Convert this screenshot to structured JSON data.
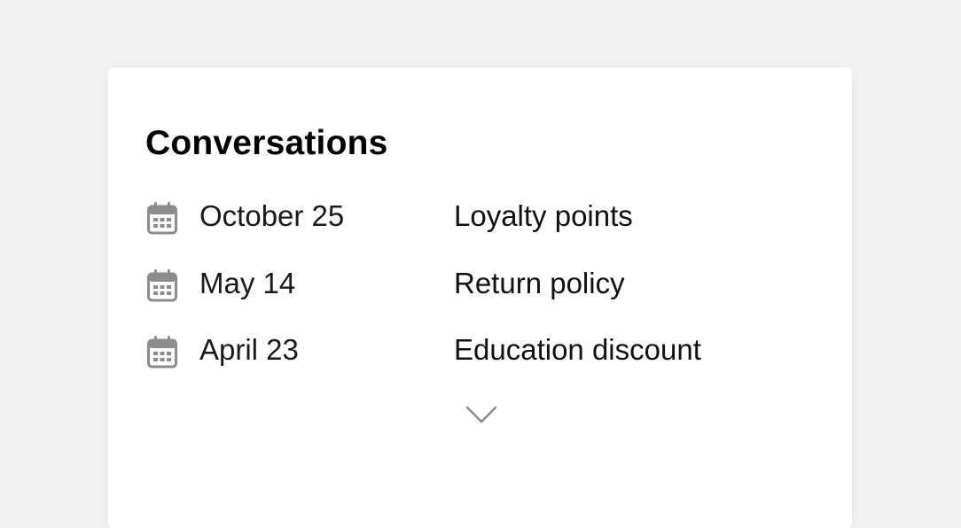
{
  "card": {
    "title": "Conversations",
    "rows": [
      {
        "date": "October 25",
        "topic": "Loyalty points",
        "icon": "calendar-icon"
      },
      {
        "date": "May 14",
        "topic": "Return policy",
        "icon": "calendar-icon"
      },
      {
        "date": "April 23",
        "topic": "Education discount",
        "icon": "calendar-icon"
      }
    ],
    "expand_icon": "chevron-down-icon"
  },
  "colors": {
    "background": "#f2f2f2",
    "card": "#ffffff",
    "icon": "#8c8c8c",
    "text": "#111111"
  }
}
